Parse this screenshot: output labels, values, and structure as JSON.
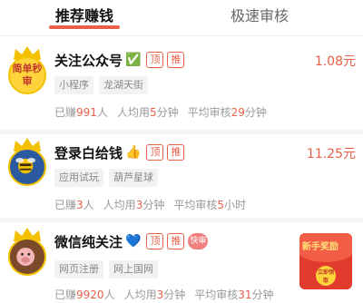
{
  "tabs": [
    {
      "label": "推荐赚钱"
    },
    {
      "label": "极速审核"
    }
  ],
  "items": [
    {
      "avatar_text": "简单秒审",
      "title": "关注公众号",
      "emoji": "✅",
      "tags": [
        "顶",
        "推"
      ],
      "price": "1.08元",
      "chips": [
        "小程序",
        "龙湖天街"
      ],
      "stats": {
        "earned_prefix": "已赚",
        "earned": "991",
        "earned_suffix": "人",
        "avg_prefix": "人均用",
        "avg": "5",
        "avg_suffix": "分钟",
        "review_prefix": "平均审核",
        "review": "29",
        "review_suffix": "分钟"
      }
    },
    {
      "title": "登录白给钱",
      "emoji": "👍",
      "tags": [
        "顶",
        "推"
      ],
      "price": "11.25元",
      "chips": [
        "应用试玩",
        "葫芦星球"
      ],
      "stats": {
        "earned_prefix": "已赚",
        "earned": "3",
        "earned_suffix": "人",
        "avg_prefix": "人均用",
        "avg": "3",
        "avg_suffix": "分钟",
        "review_prefix": "平均审核",
        "review": "5",
        "review_suffix": "小时"
      }
    },
    {
      "title": "微信纯关注",
      "emoji": "💙",
      "tags": [
        "顶",
        "推"
      ],
      "fast_badge": "快审",
      "chips": [
        "网页注册",
        "网上国网"
      ],
      "stats": {
        "earned_prefix": "已赚",
        "earned": "9920",
        "earned_suffix": "人",
        "avg_prefix": "人均用",
        "avg": "3",
        "avg_suffix": "分钟",
        "review_prefix": "平均审核",
        "review": "31",
        "review_suffix": "分钟"
      }
    }
  ],
  "bonus": {
    "label": "新手奖励",
    "coin_text": "立即领取"
  },
  "colors": {
    "accent": "#e8604a",
    "crown": "#f4c100",
    "bonus_red": "#e23b2e"
  }
}
